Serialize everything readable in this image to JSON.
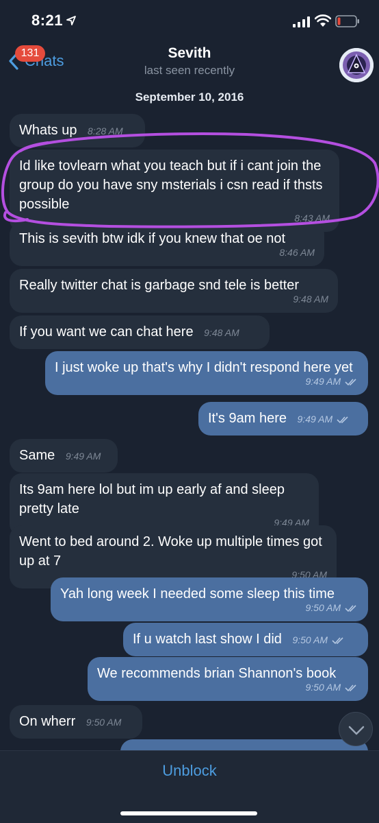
{
  "status_bar": {
    "time": "8:21"
  },
  "nav": {
    "back_label": "Chats",
    "unread_badge": "131",
    "title": "Sevith",
    "subtitle": "last seen recently"
  },
  "date_separator": "September 10, 2016",
  "messages": [
    {
      "direction": "in",
      "text": "Whats up",
      "time": "8:28 AM"
    },
    {
      "direction": "in",
      "text": "Id like tovlearn what you teach but if i cant join the group do you have sny msterials i csn read if thsts possible",
      "time": "8:43 AM"
    },
    {
      "direction": "in",
      "text": "This is sevith btw idk if you knew that oe not",
      "time": "8:46 AM"
    },
    {
      "direction": "in",
      "text": "Really twitter chat is garbage snd tele is better",
      "time": "9:48 AM"
    },
    {
      "direction": "in",
      "text": "If you want we can chat here",
      "time": "9:48 AM"
    },
    {
      "direction": "out",
      "text": "I just woke up that's why I didn't respond here yet",
      "time": "9:49 AM"
    },
    {
      "direction": "out",
      "text": "It's 9am here",
      "time": "9:49 AM"
    },
    {
      "direction": "in",
      "text": "Same",
      "time": "9:49 AM"
    },
    {
      "direction": "in",
      "text": "Its 9am here lol but im up early af and sleep pretty late",
      "time": "9:49 AM"
    },
    {
      "direction": "in",
      "text": "Went to bed around 2. Woke up multiple times got up at 7",
      "time": "9:50 AM"
    },
    {
      "direction": "out",
      "text": "Yah long week I needed some sleep this time",
      "time": "9:50 AM"
    },
    {
      "direction": "out",
      "text": "If u watch last show I did",
      "time": "9:50 AM"
    },
    {
      "direction": "out",
      "text": "We recommends brian Shannon's book",
      "time": "9:50 AM"
    },
    {
      "direction": "in",
      "text": "On wherr",
      "time": "9:50 AM"
    }
  ],
  "bottom_bar": {
    "action_label": "Unblock"
  },
  "colors": {
    "background": "#1a2230",
    "incoming_bubble": "#252f3d",
    "outgoing_bubble": "#4b6fa0",
    "accent": "#4d9de0",
    "badge": "#e54b3c",
    "highlight_annotation": "#b44fe0"
  },
  "icons": [
    "location-arrow-icon",
    "signal-icon",
    "wifi-icon",
    "battery-icon",
    "back-chevron-icon",
    "read-ticks-icon",
    "chevron-down-icon"
  ]
}
